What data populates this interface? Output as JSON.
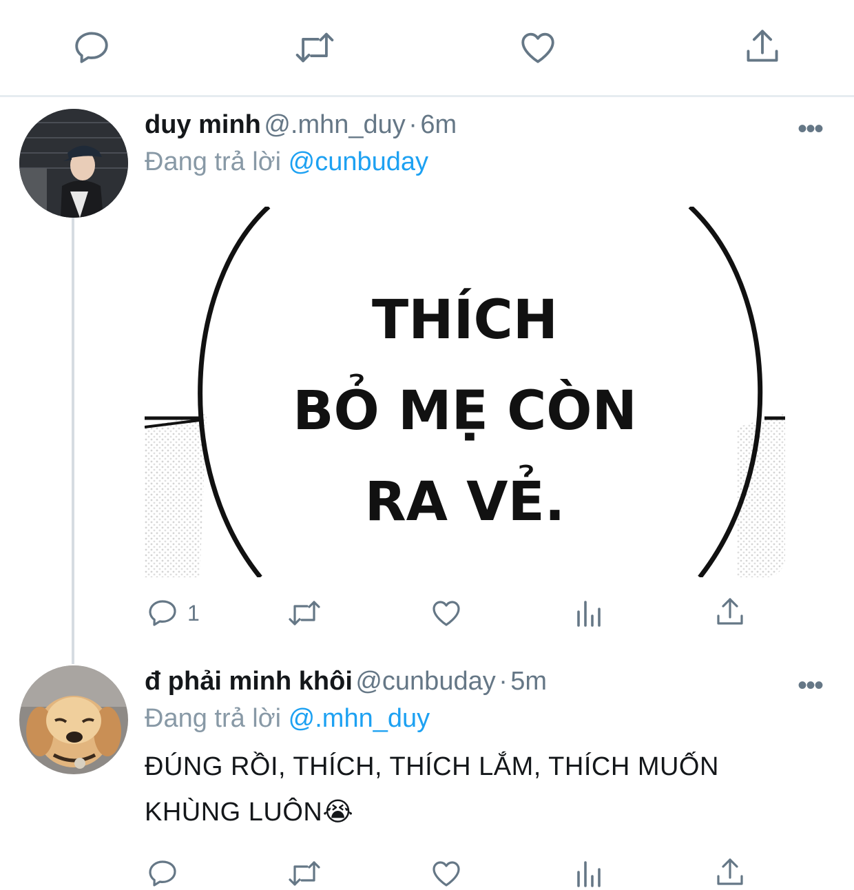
{
  "top_actions": {
    "reply_icon": "comment-icon",
    "retweet_icon": "retweet-icon",
    "like_icon": "heart-icon",
    "share_icon": "share-icon"
  },
  "tweets": [
    {
      "display_name": "duy minh",
      "handle": "@.mhn_duy",
      "separator": "·",
      "time": "6m",
      "replying_prefix": "Đang trả lời",
      "replying_to": "@cunbuday",
      "media_text": [
        "THÍCH",
        "BỎ MẸ CÒN",
        "RA VẺ."
      ],
      "actions": {
        "reply_count": "1"
      }
    },
    {
      "display_name": "đ phải minh khôi",
      "handle": "@cunbuday",
      "separator": "·",
      "time": "5m",
      "replying_prefix": "Đang trả lời",
      "replying_to": "@.mhn_duy",
      "text_line1": "ĐÚNG RỒI, THÍCH, THÍCH LẮM, THÍCH MUỐN",
      "text_line2": "KHÙNG LUÔN😭",
      "actions": {
        "reply_count": ""
      }
    }
  ],
  "more_label": "•••",
  "colors": {
    "accent": "#1da1f2",
    "muted": "#657786",
    "divider": "#e6ecf0"
  }
}
